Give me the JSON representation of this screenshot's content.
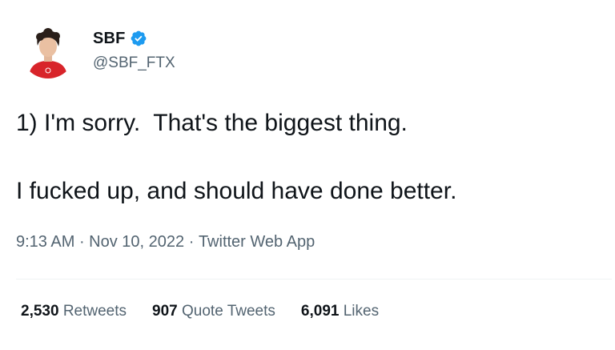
{
  "author": {
    "display_name": "SBF",
    "handle": "@SBF_FTX",
    "verified": true,
    "verified_icon": "verified-badge-icon",
    "verified_color": "#1d9bf0"
  },
  "tweet": {
    "line1": "1) I'm sorry.  That's the biggest thing.",
    "line2": "I fucked up, and should have done better."
  },
  "meta": {
    "time": "9:13 AM",
    "separator": " · ",
    "date": "Nov 10, 2022",
    "source": "Twitter Web App"
  },
  "stats": [
    {
      "count": "2,530",
      "label": "Retweets"
    },
    {
      "count": "907",
      "label": "Quote Tweets"
    },
    {
      "count": "6,091",
      "label": "Likes"
    }
  ],
  "colors": {
    "text": "#0f1419",
    "secondary": "#536471",
    "divider": "#eff3f4",
    "shirt": "#d8242a"
  }
}
